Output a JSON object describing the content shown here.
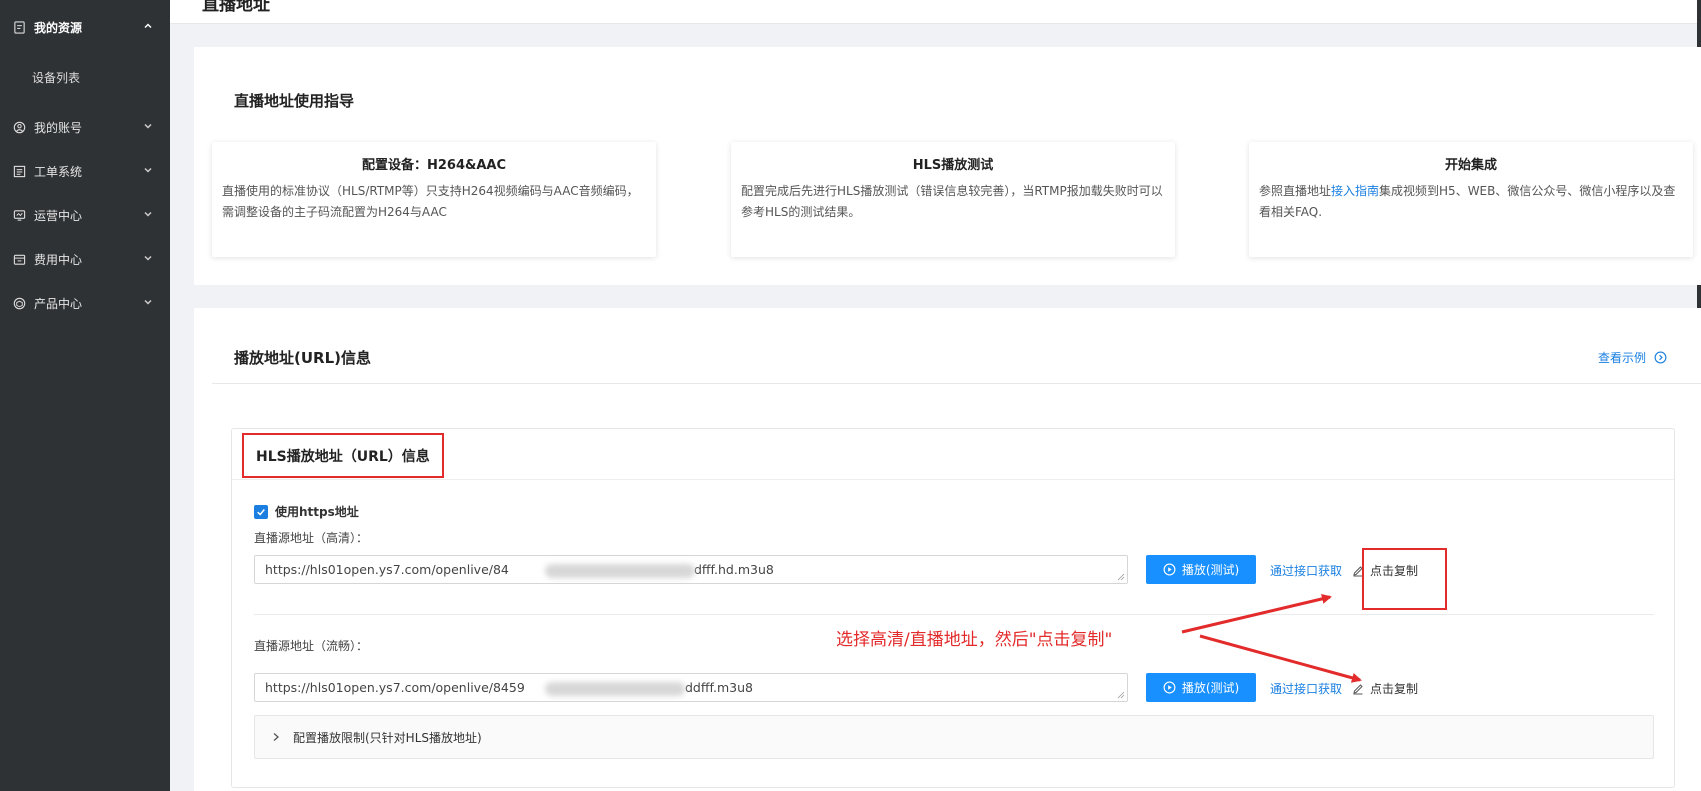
{
  "sidebar": {
    "items": [
      {
        "label": "我的资源",
        "icon": "document-icon",
        "expanded": true
      },
      {
        "label": "设备列表",
        "sub": true
      },
      {
        "label": "我的账号",
        "icon": "user-circle-icon"
      },
      {
        "label": "工单系统",
        "icon": "list-icon"
      },
      {
        "label": "运营中心",
        "icon": "monitor-icon"
      },
      {
        "label": "费用中心",
        "icon": "wallet-icon"
      },
      {
        "label": "产品中心",
        "icon": "cube-icon"
      }
    ]
  },
  "page": {
    "title": "直播地址"
  },
  "guide": {
    "title": "直播地址使用指导",
    "boxes": [
      {
        "title": "配置设备：H264&AAC",
        "desc": "直播使用的标准协议（HLS/RTMP等）只支持H264视频编码与AAC音频编码，需调整设备的主子码流配置为H264与AAC"
      },
      {
        "title": "HLS播放测试",
        "desc": "配置完成后先进行HLS播放测试（错误信息较完善），当RTMP报加载失败时可以参考HLS的测试结果。"
      },
      {
        "title": "开始集成",
        "desc_pre": "参照直播地址",
        "desc_link": "接入指南",
        "desc_post": "集成视频到H5、WEB、微信公众号、微信小程序以及查看相关FAQ."
      }
    ]
  },
  "url_info": {
    "title": "播放地址(URL)信息",
    "example_link": "查看示例",
    "hls": {
      "title": "HLS播放地址（URL）信息",
      "https_checkbox": "使用https地址",
      "https_checked": true,
      "hd": {
        "label": "直播源地址（高清）：",
        "url_prefix": "https://hls01open.ys7.com/openlive/84",
        "url_suffix": "dfff.hd.m3u8"
      },
      "smooth": {
        "label": "直播源地址（流畅）：",
        "url_prefix": "https://hls01open.ys7.com/openlive/8459",
        "url_suffix": "ddfff.m3u8"
      },
      "play_button": "播放(测试)",
      "api_link": "通过接口获取",
      "copy_link": "点击复制",
      "collapse_label": "配置播放限制(只针对HLS播放地址)"
    }
  },
  "annotation": {
    "text": "选择高清/直播地址，然后\"点击复制\""
  },
  "colors": {
    "accent": "#1890ff",
    "link": "#1a7fe0",
    "annotation": "#e32b2b",
    "sidebar": "#2f3235"
  }
}
